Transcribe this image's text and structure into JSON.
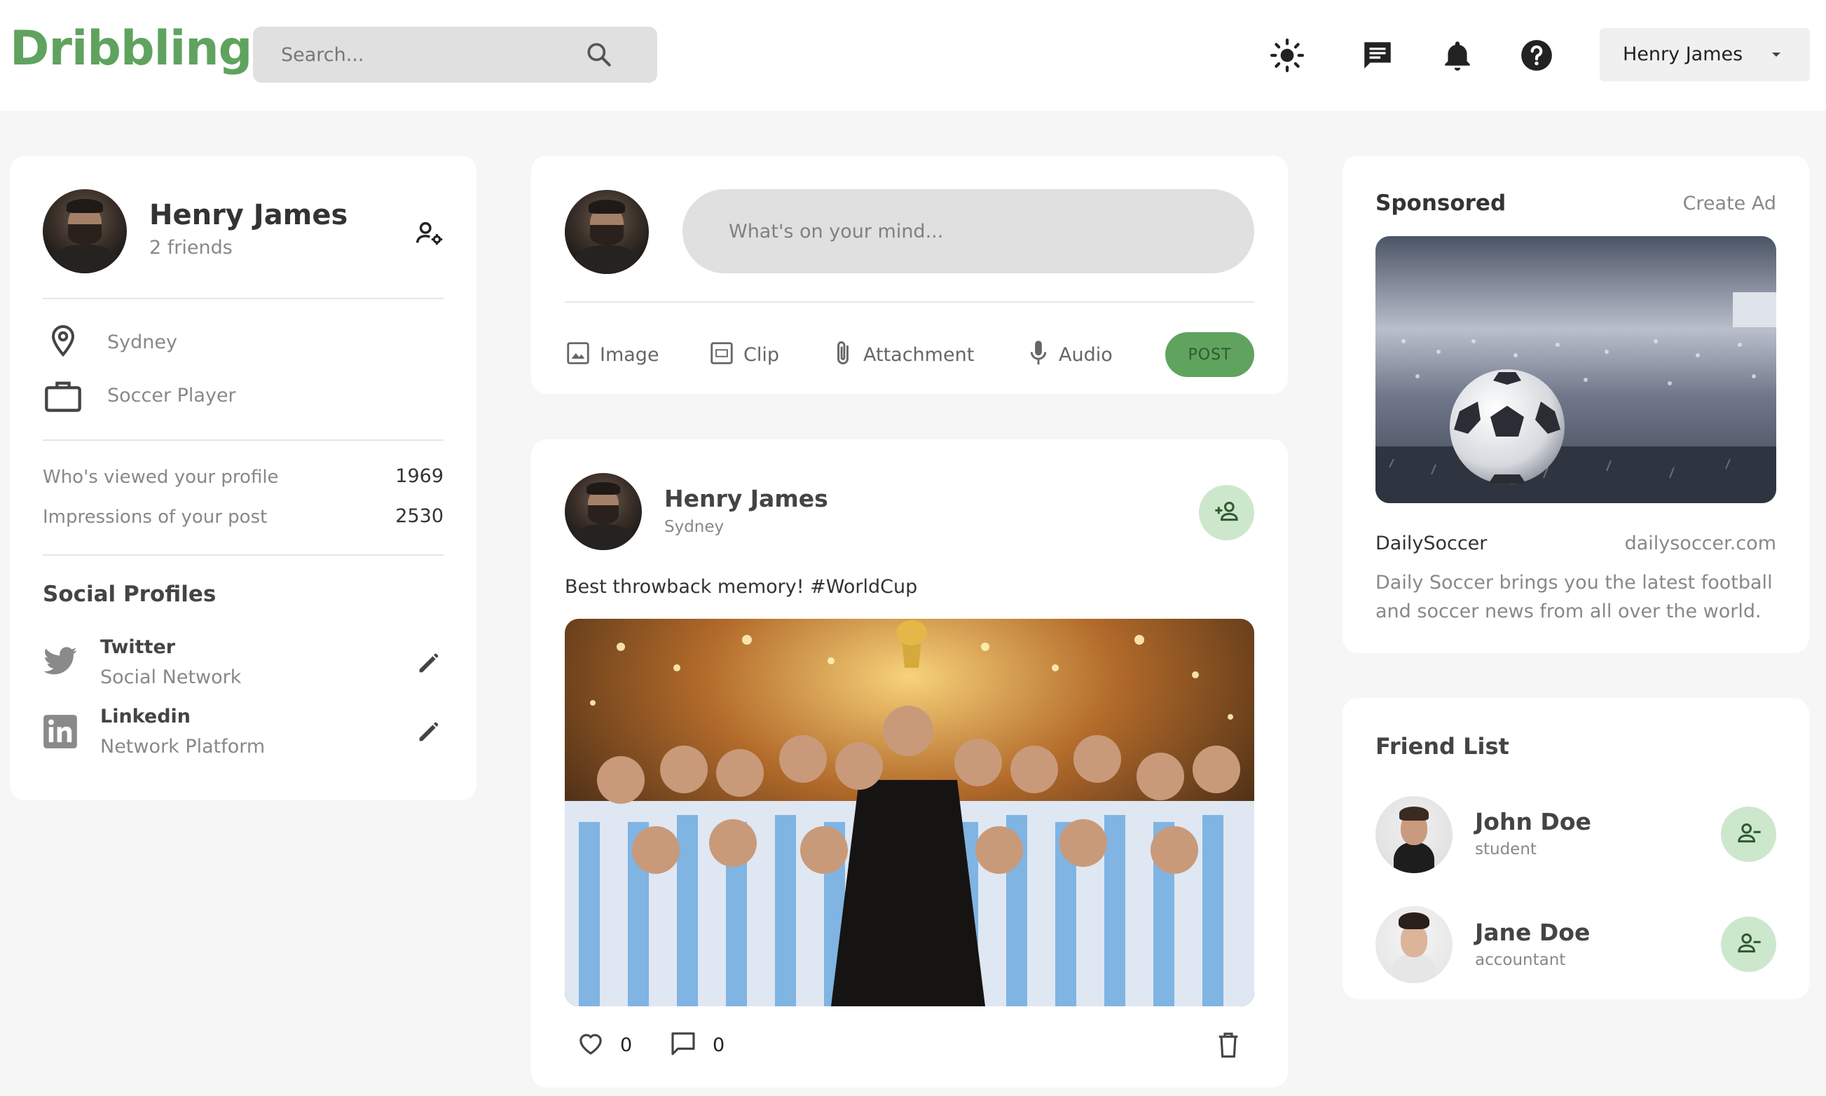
{
  "header": {
    "logo": "Dribbling",
    "search_placeholder": "Search...",
    "icons": [
      "light-mode-icon",
      "chat-icon",
      "notifications-icon",
      "help-icon"
    ],
    "user_name": "Henry James"
  },
  "profile": {
    "name": "Henry James",
    "friends": "2 friends",
    "location": "Sydney",
    "occupation": "Soccer Player",
    "stats": [
      {
        "label": "Who's viewed your profile",
        "value": "1969"
      },
      {
        "label": "Impressions of your post",
        "value": "2530"
      }
    ],
    "social_title": "Social Profiles",
    "social": [
      {
        "name": "Twitter",
        "type": "Social Network"
      },
      {
        "name": "Linkedin",
        "type": "Network Platform"
      }
    ]
  },
  "composer": {
    "placeholder": "What's on your mind...",
    "actions": [
      "Image",
      "Clip",
      "Attachment",
      "Audio"
    ],
    "post_label": "POST"
  },
  "post": {
    "author": "Henry James",
    "location": "Sydney",
    "text": "Best throwback memory! #WorldCup",
    "likes": "0",
    "comments": "0"
  },
  "sponsored": {
    "title": "Sponsored",
    "create_ad": "Create Ad",
    "brand": "DailySoccer",
    "url": "dailysoccer.com",
    "description_line1": "Daily Soccer brings you the latest football",
    "description_line2": "and soccer news from all over the world."
  },
  "friends": {
    "title": "Friend List",
    "items": [
      {
        "name": "John Doe",
        "role": "student"
      },
      {
        "name": "Jane Doe",
        "role": "accountant"
      }
    ]
  },
  "colors": {
    "accent": "#5fa35f",
    "accent_light": "#cde7cd",
    "background": "#f6f6f6"
  }
}
